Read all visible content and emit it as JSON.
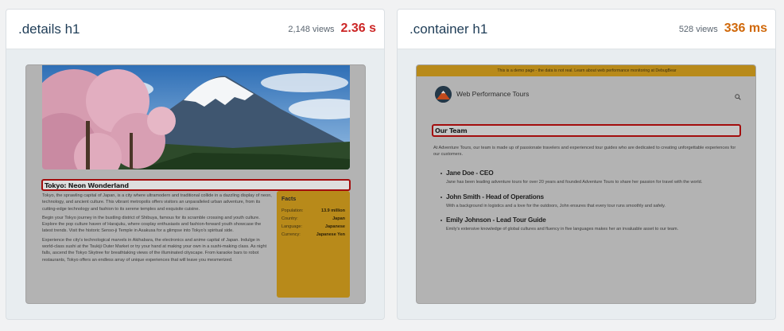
{
  "cards": [
    {
      "selector": ".details h1",
      "views": "2,148 views",
      "timing": "2.36 s",
      "timing_color": "#cc2626",
      "preview": {
        "heading": "Tokyo: Neon Wonderland",
        "paragraphs": [
          "Tokyo, the sprawling capital of Japan, is a city where ultramodern and traditional collide in a dazzling display of neon, technology, and ancient culture. This vibrant metropolis offers visitors an unparalleled urban adventure, from its cutting-edge technology and fashion to its serene temples and exquisite cuisine.",
          "Begin your Tokyo journey in the bustling district of Shibuya, famous for its scramble crossing and youth culture. Explore the pop culture haven of Harajuku, where cosplay enthusiasts and fashion-forward youth showcase the latest trends. Visit the historic Senso-ji Temple in Asakusa for a glimpse into Tokyo's spiritual side.",
          "Experience the city's technological marvels in Akihabara, the electronics and anime capital of Japan. Indulge in world-class sushi at the Tsukiji Outer Market or try your hand at making your own in a sushi-making class. As night falls, ascend the Tokyo Skytree for breathtaking views of the illuminated cityscape. From karaoke bars to robot restaurants, Tokyo offers an endless array of unique experiences that will leave you mesmerized."
        ],
        "facts": {
          "title": "Facts",
          "rows": [
            {
              "key": "Population:",
              "value": "13.9 million"
            },
            {
              "key": "Country:",
              "value": "Japan"
            },
            {
              "key": "Language:",
              "value": "Japanese"
            },
            {
              "key": "Currency:",
              "value": "Japanese Yen"
            }
          ]
        }
      }
    },
    {
      "selector": ".container h1",
      "views": "528 views",
      "timing": "336 ms",
      "timing_color": "#d0690b",
      "preview": {
        "banner": "This is a demo page - the data is not real. Learn about web performance monitoring at DebugBear",
        "site_name": "Web Performance Tours",
        "heading": "Our Team",
        "intro": "At Adventure Tours, our team is made up of passionate travelers and experienced tour guides who are dedicated to creating unforgettable experiences for our customers.",
        "members": [
          {
            "name": "Jane Doe - CEO",
            "bio": "Jane has been leading adventure tours for over 20 years and founded Adventure Tours to share her passion for travel with the world."
          },
          {
            "name": "John Smith - Head of Operations",
            "bio": "With a background in logistics and a love for the outdoors, John ensures that every tour runs smoothly and safely."
          },
          {
            "name": "Emily Johnson - Lead Tour Guide",
            "bio": "Emily's extensive knowledge of global cultures and fluency in five languages makes her an invaluable asset to our team."
          }
        ]
      }
    }
  ]
}
